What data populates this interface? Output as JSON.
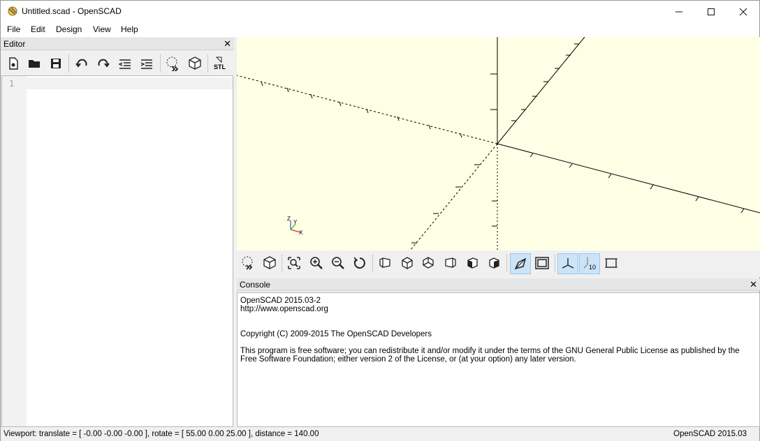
{
  "window": {
    "title": "Untitled.scad - OpenSCAD",
    "app_icon": "openscad-icon",
    "controls": [
      "minimize-icon",
      "maximize-icon",
      "close-icon"
    ]
  },
  "menubar": {
    "items": [
      {
        "label": "File"
      },
      {
        "label": "Edit"
      },
      {
        "label": "Design"
      },
      {
        "label": "View"
      },
      {
        "label": "Help"
      }
    ]
  },
  "editor": {
    "title": "Editor",
    "toolbar": [
      "new-file-icon",
      "open-file-icon",
      "save-icon",
      "undo-icon",
      "redo-icon",
      "unindent-icon",
      "indent-icon",
      "preview-icon",
      "render-icon",
      "export-stl-icon"
    ],
    "export_label": "STL",
    "line_numbers": [
      "1"
    ],
    "content": ""
  },
  "viewport": {
    "background": "#ffffe5",
    "axes_label": {
      "z": "Z",
      "y": "Y",
      "x": "X"
    }
  },
  "view_toolbar": {
    "buttons": [
      "preview-icon",
      "render-icon",
      "view-all-icon",
      "zoom-in-icon",
      "zoom-out-icon",
      "reset-view-icon",
      "view-right-icon",
      "view-top-icon",
      "view-bottom-icon",
      "view-left-icon",
      "view-front-icon",
      "view-back-icon",
      "perspective-icon",
      "orthogonal-icon",
      "show-axes-icon",
      "show-scale-markers-icon",
      "show-edges-icon"
    ],
    "scale_label": "10"
  },
  "console": {
    "title": "Console",
    "lines": [
      "OpenSCAD 2015.03-2",
      "http://www.openscad.org",
      "",
      "",
      "Copyright (C) 2009-2015 The OpenSCAD Developers",
      "",
      "This program is free software; you can redistribute it and/or modify it under the terms of the GNU General Public License as published by the",
      "Free Software Foundation; either version 2 of the License, or (at your option) any later version."
    ]
  },
  "statusbar": {
    "viewport_info": "Viewport: translate = [ -0.00 -0.00 -0.00 ], rotate = [ 55.00 0.00 25.00 ], distance = 140.00",
    "version": "OpenSCAD 2015.03"
  }
}
